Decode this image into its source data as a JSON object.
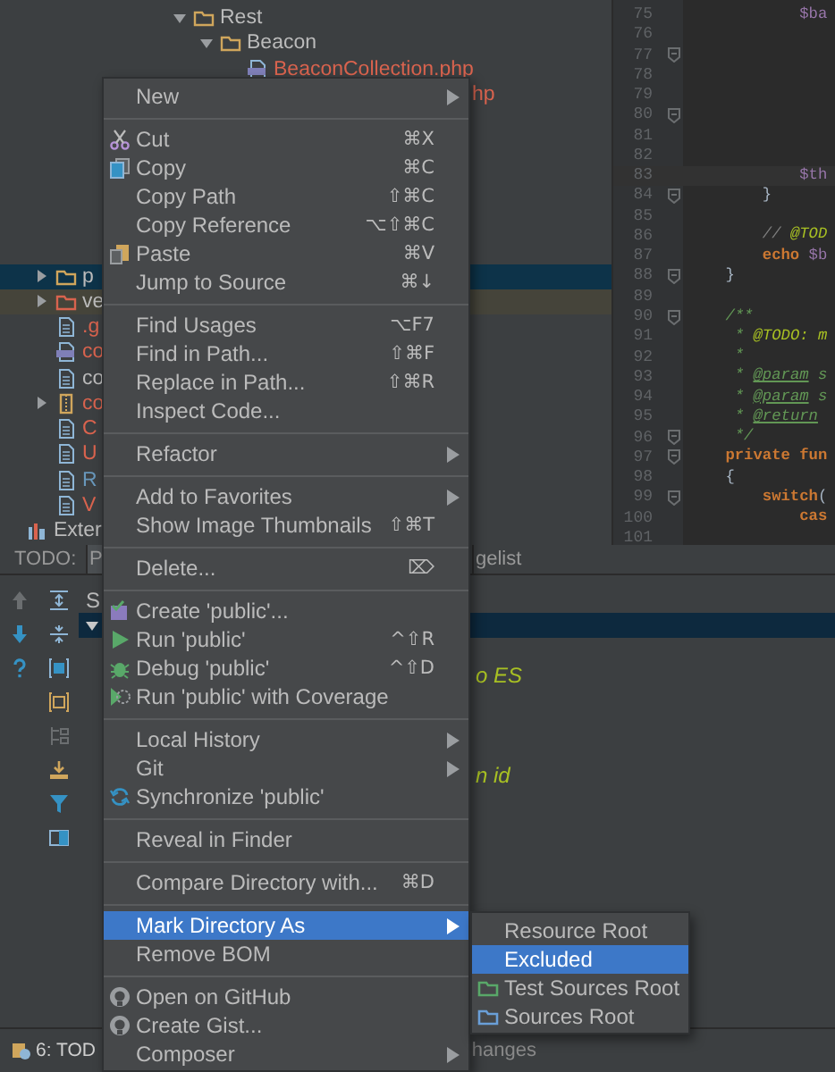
{
  "project_tree": {
    "upper": [
      {
        "label": "Rest",
        "kind": "folder",
        "expanded": true,
        "selected": false,
        "color": "#bbbbbb",
        "children": [
          {
            "label": "Beacon",
            "kind": "folder",
            "expanded": true,
            "selected": false,
            "color": "#bbbbbb",
            "children": [
              {
                "label": "BeaconCollection.php",
                "kind": "php",
                "selected": false,
                "color": "#d9634e"
              },
              {
                "label": "hp",
                "kind": "fragment",
                "selected": false,
                "color": "#d9634e"
              }
            ]
          }
        ]
      }
    ],
    "items": [
      {
        "label": "p",
        "kind": "folder",
        "expanded": false,
        "selected": true,
        "color": "#bbbbbb"
      },
      {
        "label": "ve",
        "kind": "excluded-folder",
        "expanded": false,
        "selected": false,
        "color": "#bbbbbb"
      },
      {
        "label": ".g",
        "kind": "file",
        "selected": false,
        "color": "#d9634e"
      },
      {
        "label": "co",
        "kind": "php",
        "selected": false,
        "color": "#d9634e"
      },
      {
        "label": "co",
        "kind": "file",
        "selected": false,
        "color": "#bbbbbb"
      },
      {
        "label": "co",
        "kind": "archive",
        "expanded": false,
        "selected": false,
        "color": "#d9634e"
      },
      {
        "label": "C",
        "kind": "file",
        "selected": false,
        "color": "#d9634e"
      },
      {
        "label": "U",
        "kind": "file",
        "selected": false,
        "color": "#d9634e"
      },
      {
        "label": "R",
        "kind": "file",
        "selected": false,
        "color": "#6897bb"
      },
      {
        "label": "V",
        "kind": "file",
        "selected": false,
        "color": "#d9634e"
      },
      {
        "label": "Exter",
        "kind": "library",
        "selected": false,
        "color": "#bbbbbb"
      }
    ]
  },
  "editor": {
    "lines": [
      {
        "number": "75",
        "current": false,
        "fold": false,
        "tokens": [
          {
            "text": "            $ba",
            "kind": "variable"
          }
        ]
      },
      {
        "number": "76",
        "current": false,
        "fold": false
      },
      {
        "number": "77",
        "current": false,
        "fold": true
      },
      {
        "number": "78",
        "current": false,
        "fold": false
      },
      {
        "number": "79",
        "current": false,
        "fold": false
      },
      {
        "number": "80",
        "current": false,
        "fold": true
      },
      {
        "number": "81",
        "current": false,
        "fold": false
      },
      {
        "number": "82",
        "current": false,
        "fold": false
      },
      {
        "number": "83",
        "current": true,
        "fold": false,
        "tokens": [
          {
            "text": "            $th",
            "kind": "variable"
          }
        ]
      },
      {
        "number": "84",
        "current": false,
        "fold": true,
        "tokens": [
          {
            "text": "        }",
            "kind": "plain"
          }
        ]
      },
      {
        "number": "85",
        "current": false,
        "fold": false
      },
      {
        "number": "86",
        "current": false,
        "fold": false,
        "tokens": [
          {
            "text": "        // ",
            "kind": "comment"
          },
          {
            "text": "@TOD",
            "kind": "todo"
          }
        ]
      },
      {
        "number": "87",
        "current": false,
        "fold": false,
        "tokens": [
          {
            "text": "        echo",
            "kind": "keyword"
          },
          {
            "text": " $b",
            "kind": "variable"
          }
        ]
      },
      {
        "number": "88",
        "current": false,
        "fold": true,
        "tokens": [
          {
            "text": "    }",
            "kind": "plain"
          }
        ]
      },
      {
        "number": "89",
        "current": false,
        "fold": false
      },
      {
        "number": "90",
        "current": false,
        "fold": true,
        "tokens": [
          {
            "text": "    /**",
            "kind": "doc"
          }
        ]
      },
      {
        "number": "91",
        "current": false,
        "fold": false,
        "tokens": [
          {
            "text": "     * ",
            "kind": "doc"
          },
          {
            "text": "@TODO: m",
            "kind": "todo"
          }
        ]
      },
      {
        "number": "92",
        "current": false,
        "fold": false,
        "tokens": [
          {
            "text": "     *",
            "kind": "doc"
          }
        ]
      },
      {
        "number": "93",
        "current": false,
        "fold": false,
        "tokens": [
          {
            "text": "     * ",
            "kind": "doc"
          },
          {
            "text": "@param",
            "kind": "doctag"
          },
          {
            "text": " s",
            "kind": "doc"
          }
        ]
      },
      {
        "number": "94",
        "current": false,
        "fold": false,
        "tokens": [
          {
            "text": "     * ",
            "kind": "doc"
          },
          {
            "text": "@param",
            "kind": "doctag"
          },
          {
            "text": " s",
            "kind": "doc"
          }
        ]
      },
      {
        "number": "95",
        "current": false,
        "fold": false,
        "tokens": [
          {
            "text": "     * ",
            "kind": "doc"
          },
          {
            "text": "@return",
            "kind": "doctag"
          }
        ]
      },
      {
        "number": "96",
        "current": false,
        "fold": true,
        "tokens": [
          {
            "text": "     */",
            "kind": "doc"
          }
        ]
      },
      {
        "number": "97",
        "current": false,
        "fold": true,
        "tokens": [
          {
            "text": "    private fun",
            "kind": "keyword"
          }
        ]
      },
      {
        "number": "98",
        "current": false,
        "fold": false,
        "tokens": [
          {
            "text": "    {",
            "kind": "plain"
          }
        ]
      },
      {
        "number": "99",
        "current": false,
        "fold": true,
        "tokens": [
          {
            "text": "        switch",
            "kind": "keyword"
          },
          {
            "text": "(",
            "kind": "plain"
          }
        ]
      },
      {
        "number": "100",
        "current": false,
        "fold": false,
        "tokens": [
          {
            "text": "            cas",
            "kind": "keyword"
          }
        ]
      },
      {
        "number": "101",
        "current": false,
        "fold": false
      }
    ]
  },
  "todo_panel": {
    "title": "TODO:",
    "tabs": [
      {
        "label": "P",
        "selected": true
      },
      {
        "label": "gelist",
        "selected": false
      }
    ],
    "header": "S",
    "rows": [
      {
        "selected": true,
        "expanded": true
      },
      {
        "text": "o ES",
        "selected": false
      },
      {
        "text": "n id",
        "selected": false
      }
    ]
  },
  "status_bar": {
    "items": [
      {
        "label": "6: TOD"
      },
      {
        "label": "hanges"
      }
    ]
  },
  "context_menu": {
    "groups": [
      [
        {
          "label": "New",
          "kind": "plain",
          "submenu": true,
          "selected": false
        }
      ],
      [
        {
          "label": "Cut",
          "kind": "scissors",
          "shortcut": "⌘X",
          "submenu": false,
          "selected": false
        },
        {
          "label": "Copy",
          "kind": "copy",
          "shortcut": "⌘C",
          "submenu": false,
          "selected": false
        },
        {
          "label": "Copy Path",
          "kind": "plain",
          "shortcut": "⇧⌘C",
          "submenu": false,
          "selected": false
        },
        {
          "label": "Copy Reference",
          "kind": "plain",
          "shortcut": "⌥⇧⌘C",
          "submenu": false,
          "selected": false
        },
        {
          "label": "Paste",
          "kind": "paste",
          "shortcut": "⌘V",
          "submenu": false,
          "selected": false
        },
        {
          "label": "Jump to Source",
          "kind": "plain",
          "shortcut": "⌘↓",
          "submenu": false,
          "selected": false
        }
      ],
      [
        {
          "label": "Find Usages",
          "kind": "plain",
          "shortcut": "⌥F7",
          "submenu": false,
          "selected": false
        },
        {
          "label": "Find in Path...",
          "kind": "plain",
          "shortcut": "⇧⌘F",
          "submenu": false,
          "selected": false
        },
        {
          "label": "Replace in Path...",
          "kind": "plain",
          "shortcut": "⇧⌘R",
          "submenu": false,
          "selected": false
        },
        {
          "label": "Inspect Code...",
          "kind": "plain",
          "submenu": false,
          "selected": false
        }
      ],
      [
        {
          "label": "Refactor",
          "kind": "plain",
          "submenu": true,
          "selected": false
        }
      ],
      [
        {
          "label": "Add to Favorites",
          "kind": "plain",
          "submenu": true,
          "selected": false
        },
        {
          "label": "Show Image Thumbnails",
          "kind": "plain",
          "shortcut": "⇧⌘T",
          "submenu": false,
          "selected": false
        }
      ],
      [
        {
          "label": "Delete...",
          "kind": "plain",
          "shortcut": "⌦",
          "submenu": false,
          "selected": false
        }
      ],
      [
        {
          "label": "Create 'public'...",
          "kind": "create",
          "submenu": false,
          "selected": false
        },
        {
          "label": "Run 'public'",
          "kind": "run",
          "shortcut": "^⇧R",
          "submenu": false,
          "selected": false
        },
        {
          "label": "Debug 'public'",
          "kind": "debug",
          "shortcut": "^⇧D",
          "submenu": false,
          "selected": false
        },
        {
          "label": "Run 'public' with Coverage",
          "kind": "coverage",
          "submenu": false,
          "selected": false
        }
      ],
      [
        {
          "label": "Local History",
          "kind": "plain",
          "submenu": true,
          "selected": false
        },
        {
          "label": "Git",
          "kind": "plain",
          "submenu": true,
          "selected": false
        },
        {
          "label": "Synchronize 'public'",
          "kind": "sync",
          "submenu": false,
          "selected": false
        }
      ],
      [
        {
          "label": "Reveal in Finder",
          "kind": "plain",
          "submenu": false,
          "selected": false
        }
      ],
      [
        {
          "label": "Compare Directory with...",
          "kind": "plain",
          "shortcut": "⌘D",
          "submenu": false,
          "selected": false
        }
      ],
      [
        {
          "label": "Mark Directory As",
          "kind": "plain",
          "submenu": true,
          "selected": true
        },
        {
          "label": "Remove BOM",
          "kind": "plain",
          "submenu": false,
          "selected": false
        }
      ],
      [
        {
          "label": "Open on GitHub",
          "kind": "github",
          "submenu": false,
          "selected": false
        },
        {
          "label": "Create Gist...",
          "kind": "github",
          "submenu": false,
          "selected": false
        },
        {
          "label": "Composer",
          "kind": "plain",
          "submenu": true,
          "selected": false
        }
      ]
    ]
  },
  "submenu": {
    "groups": [
      [
        {
          "label": "Resource Root",
          "kind": "plain",
          "submenu": false,
          "selected": false
        },
        {
          "label": "Excluded",
          "kind": "plain",
          "submenu": false,
          "selected": true
        },
        {
          "label": "Test Sources Root",
          "kind": "test-folder",
          "submenu": false,
          "selected": false
        },
        {
          "label": "Sources Root",
          "kind": "source-folder",
          "submenu": false,
          "selected": false
        }
      ]
    ]
  }
}
